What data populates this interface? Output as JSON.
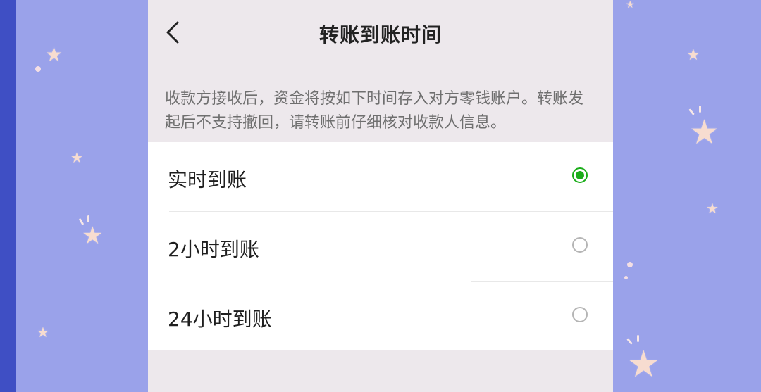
{
  "header": {
    "title": "转账到账时间"
  },
  "info": {
    "text": "收款方接收后，资金将按如下时间存入对方零钱账户。转账发起后不支持撤回，请转账前仔细核对收款人信息。"
  },
  "options": [
    {
      "label": "实时到账",
      "selected": true
    },
    {
      "label": "2小时到账",
      "selected": false
    },
    {
      "label": "24小时到账",
      "selected": false
    }
  ],
  "icons": {
    "back": "chevron-left-icon",
    "selected_radio": "radio-checked-icon",
    "unselected_radio": "radio-unchecked-icon",
    "decorations": "star-icon"
  },
  "colors": {
    "accent_green": "#1aad19",
    "background_purple": "#9aa2ea",
    "page_gray": "#ede8ec"
  }
}
